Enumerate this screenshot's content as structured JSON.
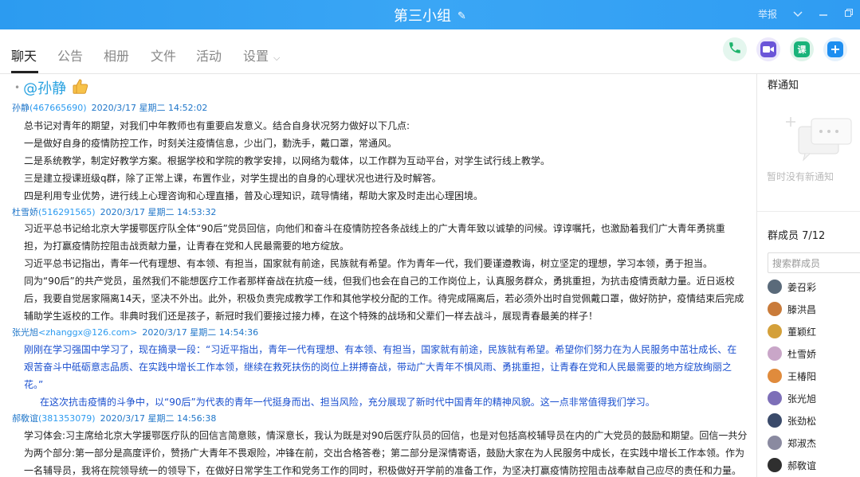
{
  "titlebar": {
    "title": "第三小组",
    "report": "举报"
  },
  "tabs": [
    {
      "label": "聊天"
    },
    {
      "label": "公告"
    },
    {
      "label": "相册"
    },
    {
      "label": "文件"
    },
    {
      "label": "活动"
    },
    {
      "label": "设置"
    }
  ],
  "actions": {
    "class_label": "课"
  },
  "chat": {
    "first_mention": "@孙静",
    "messages": [
      {
        "name": "孙静",
        "id": "(467665690)",
        "time": "2020/3/17 星期二 14:52:02",
        "lines": [
          "总书记对青年的期望，对我们中年教师也有重要启发意义。结合自身状况努力做好以下几点:",
          "一是做好自身的疫情防控工作，时刻关注疫情信息，少出门，勤洗手，戴口罩，常通风。",
          "二是系统教学，制定好教学方案。根据学校和学院的教学安排，以网络为载体，以工作群为互动平台，对学生试行线上教学。",
          "三是建立授课班级q群，除了正常上课，布置作业，对学生提出的自身的心理状况也进行及时解答。",
          "四是利用专业优势，进行线上心理咨询和心理直播，普及心理知识，疏导情绪，帮助大家及时走出心理困境。"
        ]
      },
      {
        "name": "杜雪娇",
        "id": "(516291565)",
        "time": "2020/3/17 星期二 14:53:32",
        "lines": [
          "习近平总书记给北京大学援鄂医疗队全体“90后”党员回信，向他们和奋斗在疫情防控各条战线上的广大青年致以诚挚的问候。谆谆嘱托，也激励着我们广大青年勇挑重",
          "担，为打赢疫情防控阻击战贡献力量，让青春在党和人民最需要的地方绽放。",
          "习近平总书记指出，青年一代有理想、有本领、有担当，国家就有前途，民族就有希望。作为青年一代，我们要谨遵教诲，树立坚定的理想，学习本领，勇于担当。",
          "同为“90后”的共产党员，虽然我们不能想医疗工作者那样奋战在抗疫一线，但我们也会在自己的工作岗位上，认真服务群众，勇挑重担，为抗击疫情贡献力量。近日返校",
          "后，我要自觉居家隔离14天，坚决不外出。此外，积极负责完成教学工作和其他学校分配的工作。待完成隔离后，若必须外出时自觉佩戴口罩，做好防护，疫情结束后完成",
          "辅助学生返校的工作。非典时我们还是孩子，新冠时我们要接过接力棒，在这个特殊的战场和父辈们一样去战斗，展现青春最美的样子！"
        ]
      },
      {
        "name": "张光旭",
        "id": "<zhanggx@126.com>",
        "time": "2020/3/17 星期二 14:54:36",
        "lines": [
          "刚刚在学习强国中学习了，现在摘录一段：“习近平指出，青年一代有理想、有本领、有担当，国家就有前途，民族就有希望。希望你们努力在为人民服务中茁壮成长、在",
          "艰苦奋斗中砥砺意志品质、在实践中增长工作本领，继续在救死扶伤的岗位上拼搏奋战，带动广大青年不惧风雨、勇挑重担，让青春在党和人民最需要的地方绽放绚丽之",
          "花。”",
          "在这次抗击疫情的斗争中，以“90后”为代表的青年一代挺身而出、担当风险，充分展现了新时代中国青年的精神风貌。这一点非常值得我们学习。"
        ]
      },
      {
        "name": "郝敎谊",
        "id": "(381353079)",
        "time": "2020/3/17 星期二 14:56:38",
        "lines": [
          "学习体会:习主席给北京大学援鄂医疗队的回信言简意赅，情深意长，我认为既是对90后医疗队员的回信，也是对包括高校辅导员在内的广大党员的鼓励和期望。回信一共分",
          "为两个部分:第一部分是高度评价，赞扬广大青年不畏艰险，冲锋在前，交出合格答卷；第二部分是深情寄语，鼓励大家在为人民服务中成长，在实践中增长工作本领。作为",
          "一名辅导员，我将在院领导统一的领导下，在做好日常学生工作和党务工作的同时，积极做好开学前的准备工作，为坚决打赢疫情防控阻击战奉献自己应尽的责任和力量。"
        ]
      }
    ]
  },
  "side": {
    "notice_title": "群通知",
    "notice_empty": "暂时没有新通知",
    "members_title": "群成员 7/12",
    "search_placeholder": "搜索群成员",
    "members": [
      {
        "name": "姜召彩"
      },
      {
        "name": "滕洪昌"
      },
      {
        "name": "董颖红"
      },
      {
        "name": "杜雪娇"
      },
      {
        "name": "王椿阳"
      },
      {
        "name": "张光旭"
      },
      {
        "name": "张劲松"
      },
      {
        "name": "郑淑杰"
      },
      {
        "name": "郝敎谊"
      }
    ]
  }
}
